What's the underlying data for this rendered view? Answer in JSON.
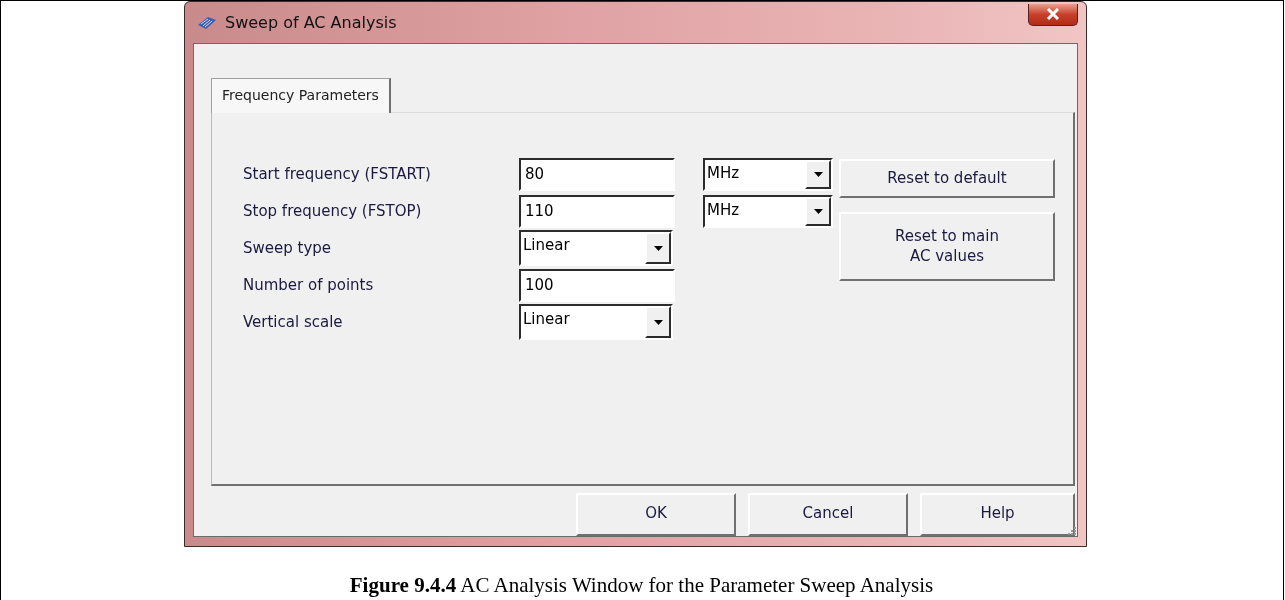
{
  "window": {
    "title": "Sweep of AC Analysis"
  },
  "tabs": [
    {
      "label": "Frequency Parameters",
      "selected": true
    }
  ],
  "parameters": [
    {
      "label": "Start frequency (FSTART)",
      "kind": "text",
      "value": "80",
      "unit": "MHz"
    },
    {
      "label": "Stop frequency (FSTOP)",
      "kind": "text",
      "value": "110",
      "unit": "MHz"
    },
    {
      "label": "Sweep type",
      "kind": "combo",
      "value": "Linear"
    },
    {
      "label": "Number of points",
      "kind": "text",
      "value": "100"
    },
    {
      "label": "Vertical scale",
      "kind": "combo",
      "value": "Linear"
    }
  ],
  "side_buttons": [
    "Reset to default",
    "Reset to main\nAC values"
  ],
  "buttons": [
    "OK",
    "Cancel",
    "Help"
  ],
  "caption": "**Figure 9.4.4**  AC Analysis Window for the Parameter Sweep Analysis"
}
